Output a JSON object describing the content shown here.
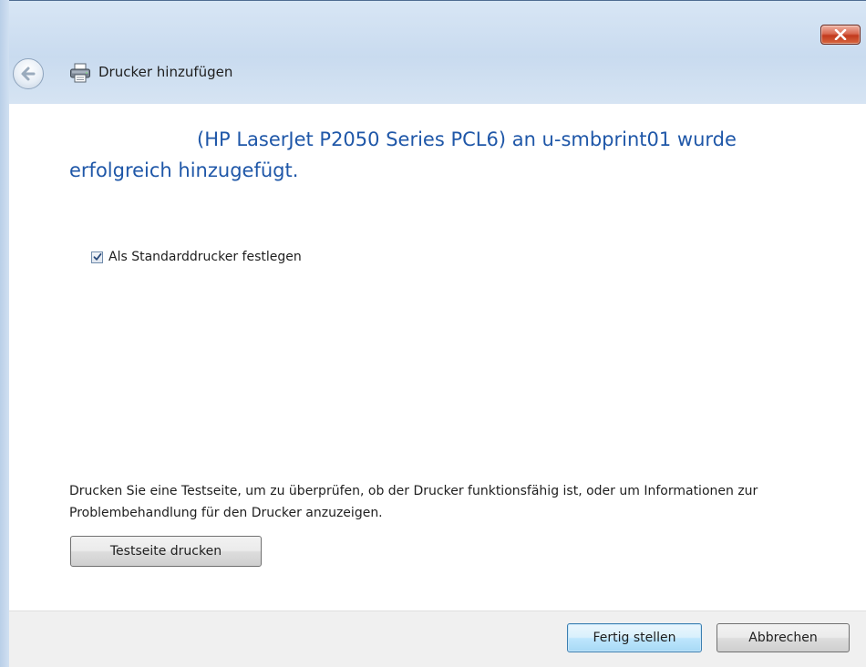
{
  "window": {
    "close_label": "✕"
  },
  "wizard": {
    "title": "Drucker hinzufügen"
  },
  "content": {
    "headline": "(HP LaserJet P2050 Series PCL6) an u-smbprint01 wurde erfolgreich hinzugefügt.",
    "default_checkbox": {
      "label": "Als Standarddrucker festlegen",
      "checked": true
    },
    "info_text": "Drucken Sie eine Testseite, um zu überprüfen, ob der Drucker funktionsfähig ist, oder um Informationen zur Problembehandlung für den Drucker anzuzeigen.",
    "test_button_label": "Testseite drucken"
  },
  "footer": {
    "finish_label": "Fertig stellen",
    "cancel_label": "Abbrechen"
  },
  "colors": {
    "headline": "#1f57a8",
    "close_button": "#c2391d",
    "default_button_border": "#3c7fb1"
  },
  "icons": {
    "back": "back-arrow-icon",
    "printer": "printer-icon",
    "close": "close-icon",
    "check": "checkmark-icon"
  }
}
